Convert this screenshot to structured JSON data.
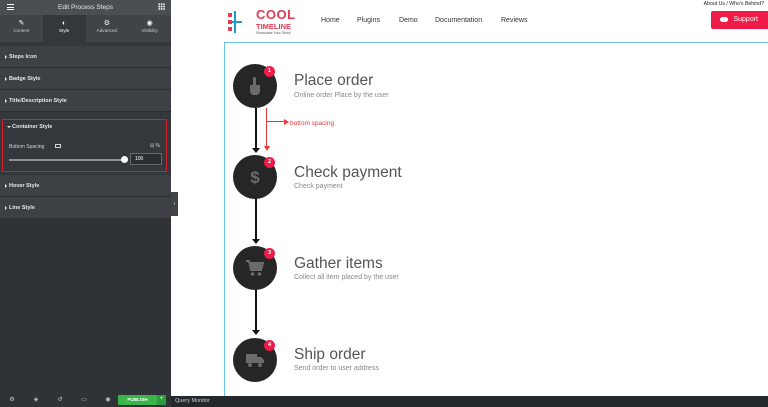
{
  "editor": {
    "title": "Edit Process Steps",
    "tabs": [
      {
        "label": "Content",
        "icon": "pencil-icon",
        "glyph": "✎"
      },
      {
        "label": "Style",
        "icon": "half-circle-icon",
        "glyph": "◐"
      },
      {
        "label": "Advanced",
        "icon": "gear-icon",
        "glyph": "⚙"
      },
      {
        "label": "Visibility",
        "icon": "eye-icon",
        "glyph": "◉"
      }
    ],
    "active_tab": "Style",
    "sections": [
      {
        "label": "Steps Icon"
      },
      {
        "label": "Badge Style"
      },
      {
        "label": "Title/Description Style"
      },
      {
        "label": "Container Style"
      },
      {
        "label": "Hover Style"
      },
      {
        "label": "Line Style"
      }
    ],
    "control": {
      "label": "Bottom Spacing",
      "unit": "%",
      "value": "100",
      "slider_fraction": 0.97
    },
    "footer": {
      "publish_label": "PUBLISH",
      "more_label": "+"
    }
  },
  "site": {
    "top_link": "About Us / Who's Behind?",
    "logo": {
      "cool": "COOL",
      "timeline": "TIMELINE",
      "tagline": "Showcase Your Story!"
    },
    "nav": [
      "Home",
      "Plugins",
      "Demo",
      "Documentation",
      "Reviews"
    ],
    "support_label": "Support"
  },
  "steps": [
    {
      "number": "1",
      "title": "Place order",
      "description": "Online order Place by the user",
      "icon": "hand-pointer-icon"
    },
    {
      "number": "2",
      "title": "Check payment",
      "description": "Check payment",
      "icon": "dollar-icon"
    },
    {
      "number": "3",
      "title": "Gather items",
      "description": "Collect all item placed by the user",
      "icon": "cart-icon"
    },
    {
      "number": "4",
      "title": "Ship order",
      "description": "Send order to user address",
      "icon": "truck-icon"
    }
  ],
  "annotation": {
    "label": "bottom spacing",
    "color": "#e53935"
  },
  "status_bar": "Query Monitor",
  "colors": {
    "accent": "#ee1c47",
    "panel_bg": "#34383c",
    "publish": "#39b54a",
    "step_circle": "#262626",
    "highlight_box": "#d42027"
  }
}
